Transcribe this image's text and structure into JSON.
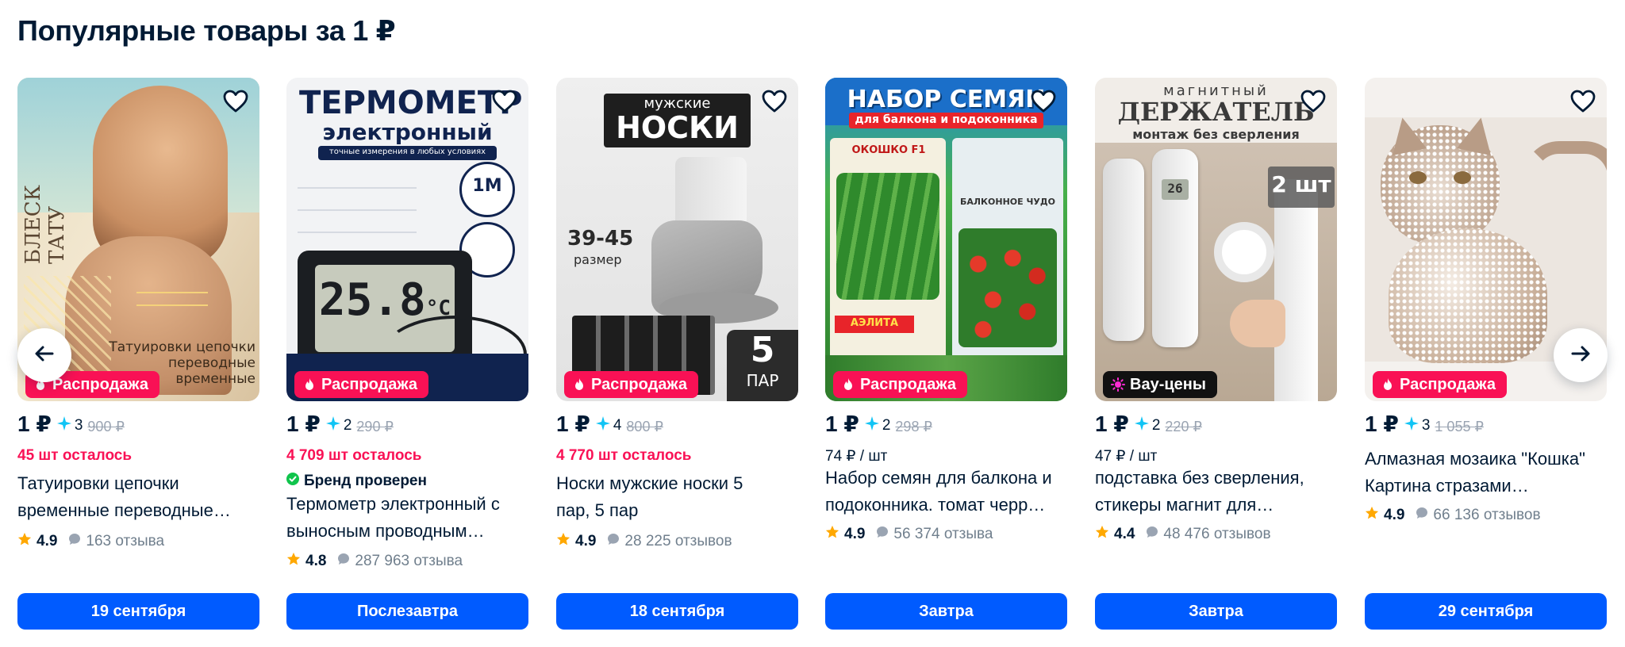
{
  "section": {
    "title": "Популярные товары за 1 ₽"
  },
  "colors": {
    "accent": "#005bff",
    "sale": "#f91155",
    "text": "#001a34",
    "muted": "#707f8d",
    "old_price": "#9aa4b2",
    "star": "#ffa800",
    "bonus": "#10c4f5"
  },
  "nav": {
    "prev_icon": "arrow-left-icon",
    "next_icon": "arrow-right-icon"
  },
  "products": [
    {
      "badge": "Распродажа",
      "badge_type": "sale",
      "price": "1 ₽",
      "bonus": "3",
      "old_price": "900 ₽",
      "left_count": "45 шт осталось",
      "title_l1": "Татуировки цепочки",
      "title_l2": "временные переводные…",
      "rating": "4.9",
      "reviews": "163 отзыва",
      "delivery": "19 сентября",
      "art": {
        "left_text": "БЛЕСК ТАТУ",
        "caption1": "Татуировки цепочки",
        "caption2": "переводные",
        "caption3": "временные"
      }
    },
    {
      "badge": "Распродажа",
      "badge_type": "sale",
      "price": "1 ₽",
      "bonus": "2",
      "old_price": "290 ₽",
      "left_count": "4 709 шт осталось",
      "brand": "Бренд проверен",
      "title_l1": "Термометр электронный с",
      "title_l2": "выносным проводным…",
      "rating": "4.8",
      "reviews": "287 963 отзыва",
      "delivery": "Послезавтра",
      "art": {
        "h1": "ТЕРМОМЕТР",
        "h2": "электронный",
        "sub": "точные измерения в любых условиях",
        "display": "25.8",
        "unit": "°C",
        "tag": "1М"
      }
    },
    {
      "badge": "Распродажа",
      "badge_type": "sale",
      "price": "1 ₽",
      "bonus": "4",
      "old_price": "800 ₽",
      "left_count": "4 770 шт осталось",
      "title_l1": "Носки мужские носки 5",
      "title_l2": "пар, 5 пар",
      "rating": "4.9",
      "reviews": "28 225 отзывов",
      "delivery": "18 сентября",
      "art": {
        "h2": "мужские",
        "h1": "НОСКИ",
        "size": "39-45",
        "size_label": "размер",
        "count": "5",
        "count_label": "ПАР"
      }
    },
    {
      "badge": "Распродажа",
      "badge_type": "sale",
      "price": "1 ₽",
      "bonus": "2",
      "old_price": "298 ₽",
      "unit_price": "74 ₽ / шт",
      "title_l1": "Набор семян для балкона и",
      "title_l2": "подоконника. томат черр…",
      "rating": "4.9",
      "reviews": "56 374 отзыва",
      "delivery": "Завтра",
      "art": {
        "h1": "НАБОР СЕМЯН",
        "h2": "для балкона и подоконника",
        "pack1": "ОКОШКО F1",
        "pack2": "БАЛКОННОЕ ЧУДО",
        "brand": "АЭЛИТА"
      }
    },
    {
      "badge": "Вау-цены",
      "badge_type": "wow",
      "price": "1 ₽",
      "bonus": "2",
      "old_price": "220 ₽",
      "unit_price": "47 ₽ / шт",
      "title_l1": "подставка без сверления,",
      "title_l2": "стикеры магнит для…",
      "rating": "4.4",
      "reviews": "48 476 отзывов",
      "delivery": "Завтра",
      "art": {
        "h2": "магнитный",
        "h1": "ДЕРЖАТЕЛЬ",
        "sub": "монтаж без сверления",
        "count": "2 шт",
        "display": "26"
      }
    },
    {
      "badge": "Распродажа",
      "badge_type": "sale",
      "price": "1 ₽",
      "bonus": "3",
      "old_price": "1 055 ₽",
      "title_l1": "Алмазная мозаика \"Кошка\"",
      "title_l2": "Картина стразами…",
      "rating": "4.9",
      "reviews": "66 136 отзывов",
      "delivery": "29 сентября",
      "art": {}
    }
  ]
}
